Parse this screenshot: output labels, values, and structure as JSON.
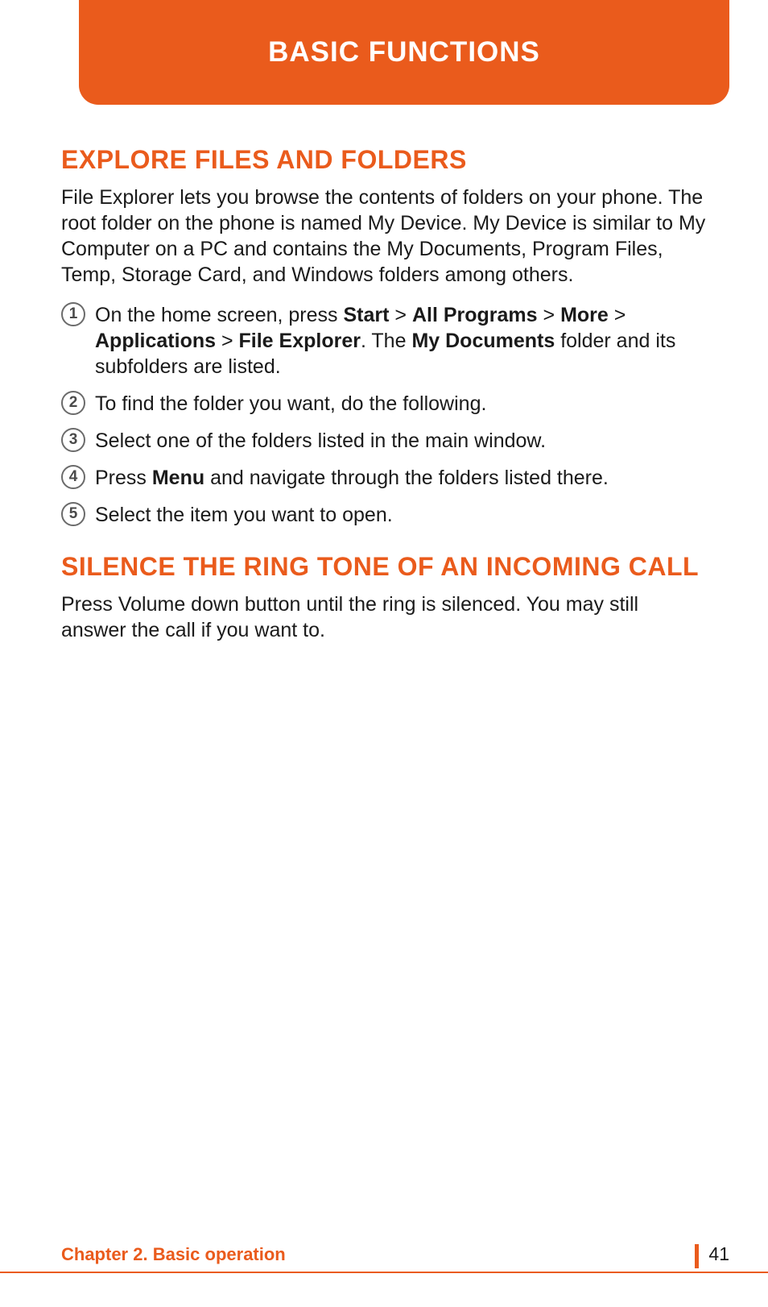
{
  "header": {
    "title": "BASIC FUNCTIONS"
  },
  "section1": {
    "heading": "EXPLORE FILES AND FOLDERS",
    "intro": "File Explorer lets you browse the contents of folders on your phone. The root folder on the phone is named My Device. My Device is similar to My Computer on a PC and contains the My Documents, Program Files, Temp, Storage Card, and Windows folders among others.",
    "steps": [
      {
        "num": "1",
        "prefix": "On the home screen, press ",
        "b1": "Start",
        "s1": " > ",
        "b2": "All Programs",
        "s2": " > ",
        "b3": "More",
        "s3": " > ",
        "b4": "Applications",
        "s4": " > ",
        "b5": "File Explorer",
        "s5": ". The ",
        "b6": "My Documents",
        "suffix": " folder and its subfolders are listed."
      },
      {
        "num": "2",
        "text": "To find the folder you want, do the following."
      },
      {
        "num": "3",
        "text": "Select one of the folders listed in the main window."
      },
      {
        "num": "4",
        "prefix": "Press ",
        "b1": "Menu",
        "suffix": " and navigate through the folders listed there."
      },
      {
        "num": "5",
        "text": "Select the item you want to open."
      }
    ]
  },
  "section2": {
    "heading": "SILENCE THE RING TONE OF AN INCOMING CALL",
    "body": "Press Volume down button until the ring is silenced. You may still answer the call if you want to."
  },
  "footer": {
    "chapter": "Chapter 2. Basic operation",
    "page": "41"
  }
}
